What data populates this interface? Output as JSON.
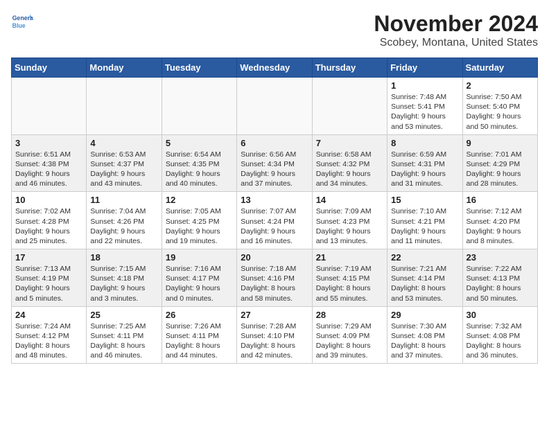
{
  "header": {
    "logo_line1": "General",
    "logo_line2": "Blue",
    "title": "November 2024",
    "subtitle": "Scobey, Montana, United States"
  },
  "columns": [
    "Sunday",
    "Monday",
    "Tuesday",
    "Wednesday",
    "Thursday",
    "Friday",
    "Saturday"
  ],
  "weeks": [
    {
      "shade": "odd",
      "days": [
        {
          "num": "",
          "info": ""
        },
        {
          "num": "",
          "info": ""
        },
        {
          "num": "",
          "info": ""
        },
        {
          "num": "",
          "info": ""
        },
        {
          "num": "",
          "info": ""
        },
        {
          "num": "1",
          "info": "Sunrise: 7:48 AM\nSunset: 5:41 PM\nDaylight: 9 hours\nand 53 minutes."
        },
        {
          "num": "2",
          "info": "Sunrise: 7:50 AM\nSunset: 5:40 PM\nDaylight: 9 hours\nand 50 minutes."
        }
      ]
    },
    {
      "shade": "even",
      "days": [
        {
          "num": "3",
          "info": "Sunrise: 6:51 AM\nSunset: 4:38 PM\nDaylight: 9 hours\nand 46 minutes."
        },
        {
          "num": "4",
          "info": "Sunrise: 6:53 AM\nSunset: 4:37 PM\nDaylight: 9 hours\nand 43 minutes."
        },
        {
          "num": "5",
          "info": "Sunrise: 6:54 AM\nSunset: 4:35 PM\nDaylight: 9 hours\nand 40 minutes."
        },
        {
          "num": "6",
          "info": "Sunrise: 6:56 AM\nSunset: 4:34 PM\nDaylight: 9 hours\nand 37 minutes."
        },
        {
          "num": "7",
          "info": "Sunrise: 6:58 AM\nSunset: 4:32 PM\nDaylight: 9 hours\nand 34 minutes."
        },
        {
          "num": "8",
          "info": "Sunrise: 6:59 AM\nSunset: 4:31 PM\nDaylight: 9 hours\nand 31 minutes."
        },
        {
          "num": "9",
          "info": "Sunrise: 7:01 AM\nSunset: 4:29 PM\nDaylight: 9 hours\nand 28 minutes."
        }
      ]
    },
    {
      "shade": "odd",
      "days": [
        {
          "num": "10",
          "info": "Sunrise: 7:02 AM\nSunset: 4:28 PM\nDaylight: 9 hours\nand 25 minutes."
        },
        {
          "num": "11",
          "info": "Sunrise: 7:04 AM\nSunset: 4:26 PM\nDaylight: 9 hours\nand 22 minutes."
        },
        {
          "num": "12",
          "info": "Sunrise: 7:05 AM\nSunset: 4:25 PM\nDaylight: 9 hours\nand 19 minutes."
        },
        {
          "num": "13",
          "info": "Sunrise: 7:07 AM\nSunset: 4:24 PM\nDaylight: 9 hours\nand 16 minutes."
        },
        {
          "num": "14",
          "info": "Sunrise: 7:09 AM\nSunset: 4:23 PM\nDaylight: 9 hours\nand 13 minutes."
        },
        {
          "num": "15",
          "info": "Sunrise: 7:10 AM\nSunset: 4:21 PM\nDaylight: 9 hours\nand 11 minutes."
        },
        {
          "num": "16",
          "info": "Sunrise: 7:12 AM\nSunset: 4:20 PM\nDaylight: 9 hours\nand 8 minutes."
        }
      ]
    },
    {
      "shade": "even",
      "days": [
        {
          "num": "17",
          "info": "Sunrise: 7:13 AM\nSunset: 4:19 PM\nDaylight: 9 hours\nand 5 minutes."
        },
        {
          "num": "18",
          "info": "Sunrise: 7:15 AM\nSunset: 4:18 PM\nDaylight: 9 hours\nand 3 minutes."
        },
        {
          "num": "19",
          "info": "Sunrise: 7:16 AM\nSunset: 4:17 PM\nDaylight: 9 hours\nand 0 minutes."
        },
        {
          "num": "20",
          "info": "Sunrise: 7:18 AM\nSunset: 4:16 PM\nDaylight: 8 hours\nand 58 minutes."
        },
        {
          "num": "21",
          "info": "Sunrise: 7:19 AM\nSunset: 4:15 PM\nDaylight: 8 hours\nand 55 minutes."
        },
        {
          "num": "22",
          "info": "Sunrise: 7:21 AM\nSunset: 4:14 PM\nDaylight: 8 hours\nand 53 minutes."
        },
        {
          "num": "23",
          "info": "Sunrise: 7:22 AM\nSunset: 4:13 PM\nDaylight: 8 hours\nand 50 minutes."
        }
      ]
    },
    {
      "shade": "odd",
      "days": [
        {
          "num": "24",
          "info": "Sunrise: 7:24 AM\nSunset: 4:12 PM\nDaylight: 8 hours\nand 48 minutes."
        },
        {
          "num": "25",
          "info": "Sunrise: 7:25 AM\nSunset: 4:11 PM\nDaylight: 8 hours\nand 46 minutes."
        },
        {
          "num": "26",
          "info": "Sunrise: 7:26 AM\nSunset: 4:11 PM\nDaylight: 8 hours\nand 44 minutes."
        },
        {
          "num": "27",
          "info": "Sunrise: 7:28 AM\nSunset: 4:10 PM\nDaylight: 8 hours\nand 42 minutes."
        },
        {
          "num": "28",
          "info": "Sunrise: 7:29 AM\nSunset: 4:09 PM\nDaylight: 8 hours\nand 39 minutes."
        },
        {
          "num": "29",
          "info": "Sunrise: 7:30 AM\nSunset: 4:08 PM\nDaylight: 8 hours\nand 37 minutes."
        },
        {
          "num": "30",
          "info": "Sunrise: 7:32 AM\nSunset: 4:08 PM\nDaylight: 8 hours\nand 36 minutes."
        }
      ]
    }
  ]
}
